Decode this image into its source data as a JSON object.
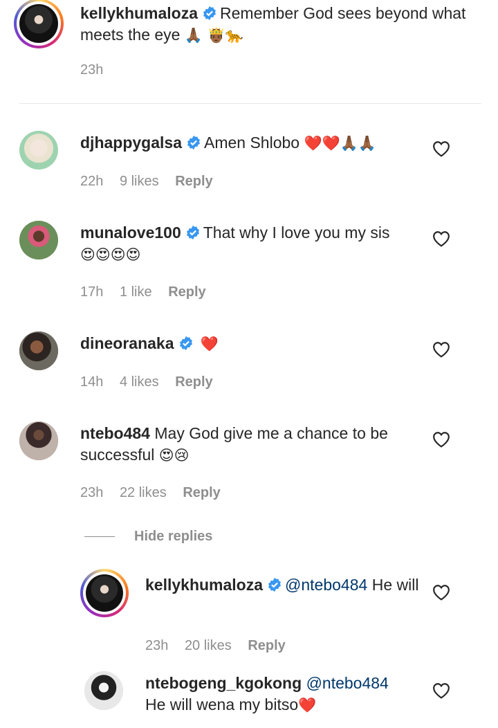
{
  "caption": {
    "username": "kellykhumaloza",
    "text": "Remember God sees beyond what meets the eye",
    "emojis": "🙏🏾 🤴🏾🐆",
    "time": "23h"
  },
  "comments": [
    {
      "username": "djhappygalsa",
      "text": "Amen Shlobo",
      "emojis": "❤️❤️🙏🏾🙏🏾",
      "time": "22h",
      "likes": "9 likes",
      "reply": "Reply",
      "avatar_color": "#cfe6d6"
    },
    {
      "username": "munalove100",
      "text": "That why I love you my sis",
      "emojis": "😍😍😍😍",
      "time": "17h",
      "likes": "1 like",
      "reply": "Reply",
      "avatar_color": "#6b8f5a"
    },
    {
      "username": "dineoranaka",
      "text": "",
      "emojis": "❤️",
      "time": "14h",
      "likes": "4 likes",
      "reply": "Reply",
      "avatar_color": "#3a2f28"
    },
    {
      "username": "ntebo484",
      "text": "May God give me a chance to be successful",
      "emojis": "😍😢",
      "time": "23h",
      "likes": "22 likes",
      "reply": "Reply",
      "avatar_color": "#8a7a72"
    }
  ],
  "hide_replies": "Hide replies",
  "replies": [
    {
      "username": "kellykhumaloza",
      "mention": "@ntebo484",
      "text": "He will",
      "emojis": "",
      "time": "23h",
      "likes": "20 likes",
      "reply": "Reply"
    },
    {
      "username": "ntebogeng_kgokong",
      "mention": "@ntebo484",
      "text": "He will wena my bitso",
      "emojis": "❤️",
      "avatar_color": "#d9d9d9"
    }
  ],
  "colors": {
    "text": "#262626",
    "secondary": "#8e8e8e",
    "mention": "#00376b",
    "verified": "#3897f0"
  }
}
